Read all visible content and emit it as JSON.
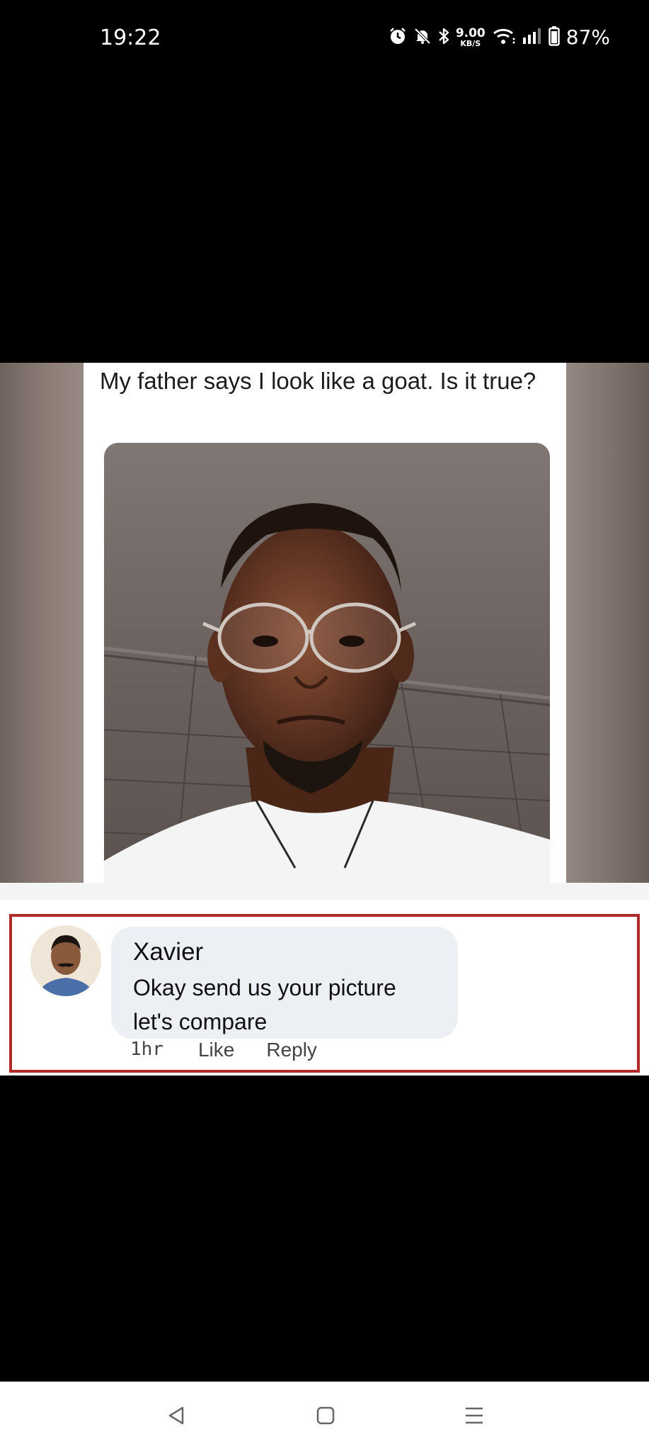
{
  "status_bar": {
    "time": "19:22",
    "icons": [
      "alarm-icon",
      "mute-icon",
      "bluetooth-icon",
      "wifi-icon",
      "signal-icon",
      "battery-icon"
    ],
    "network_speed_value": "9.00",
    "network_speed_unit": "KB/S",
    "battery_percent": "87%"
  },
  "post": {
    "question": "My father says I look like a goat. Is it true?"
  },
  "comment": {
    "author": "Xavier",
    "text": "Okay send us your picture let's compare",
    "time_ago": "1hr",
    "like_label": "Like",
    "reply_label": "Reply",
    "highlight_color": "#b02a2a"
  },
  "nav_bar": {
    "buttons": [
      "back-icon",
      "home-icon",
      "recents-icon"
    ]
  }
}
